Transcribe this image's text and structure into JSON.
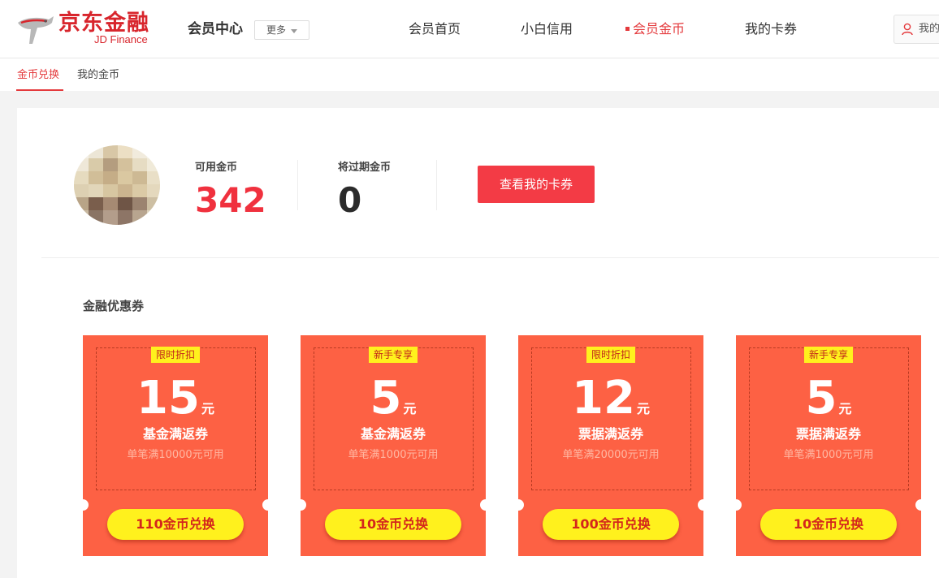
{
  "header": {
    "logo_cn": "京东金融",
    "logo_en": "JD Finance",
    "title": "会员中心",
    "more_label": "更多",
    "nav": [
      {
        "label": "会员首页",
        "active": false
      },
      {
        "label": "小白信用",
        "active": false
      },
      {
        "label": "会员金币",
        "active": true
      },
      {
        "label": "我的卡券",
        "active": false
      }
    ],
    "user_label": "我的"
  },
  "subnav": {
    "items": [
      {
        "label": "金币兑换",
        "active": true
      },
      {
        "label": "我的金币",
        "active": false
      }
    ]
  },
  "account": {
    "available_label": "可用金币",
    "available_value": "342",
    "expiring_label": "将过期金币",
    "expiring_value": "0",
    "view_coupons_label": "查看我的卡券"
  },
  "section": {
    "title": "金融优惠券"
  },
  "coupons": [
    {
      "tag": "限时折扣",
      "amount": "15",
      "unit": "元",
      "name": "基金满返券",
      "condition": "单笔满10000元可用",
      "redeem_label": "110金币兑换"
    },
    {
      "tag": "新手专享",
      "amount": "5",
      "unit": "元",
      "name": "基金满返券",
      "condition": "单笔满1000元可用",
      "redeem_label": "10金币兑换"
    },
    {
      "tag": "限时折扣",
      "amount": "12",
      "unit": "元",
      "name": "票据满返券",
      "condition": "单笔满20000元可用",
      "redeem_label": "100金币兑换"
    },
    {
      "tag": "新手专享",
      "amount": "5",
      "unit": "元",
      "name": "票据满返券",
      "condition": "单笔满1000元可用",
      "redeem_label": "10金币兑换"
    }
  ],
  "colors": {
    "brand_red": "#e4393c",
    "button_red": "#f33b45",
    "coupon_bg": "#fd6144",
    "coupon_yellow": "#fff11d",
    "value_red": "#f0313e",
    "value_dark": "#2b2b2b"
  },
  "icons": {
    "logo": "jd-dog-logo-icon",
    "user": "user-icon",
    "more_caret": "caret-down-icon",
    "avatar": "user-avatar-pixelated"
  }
}
